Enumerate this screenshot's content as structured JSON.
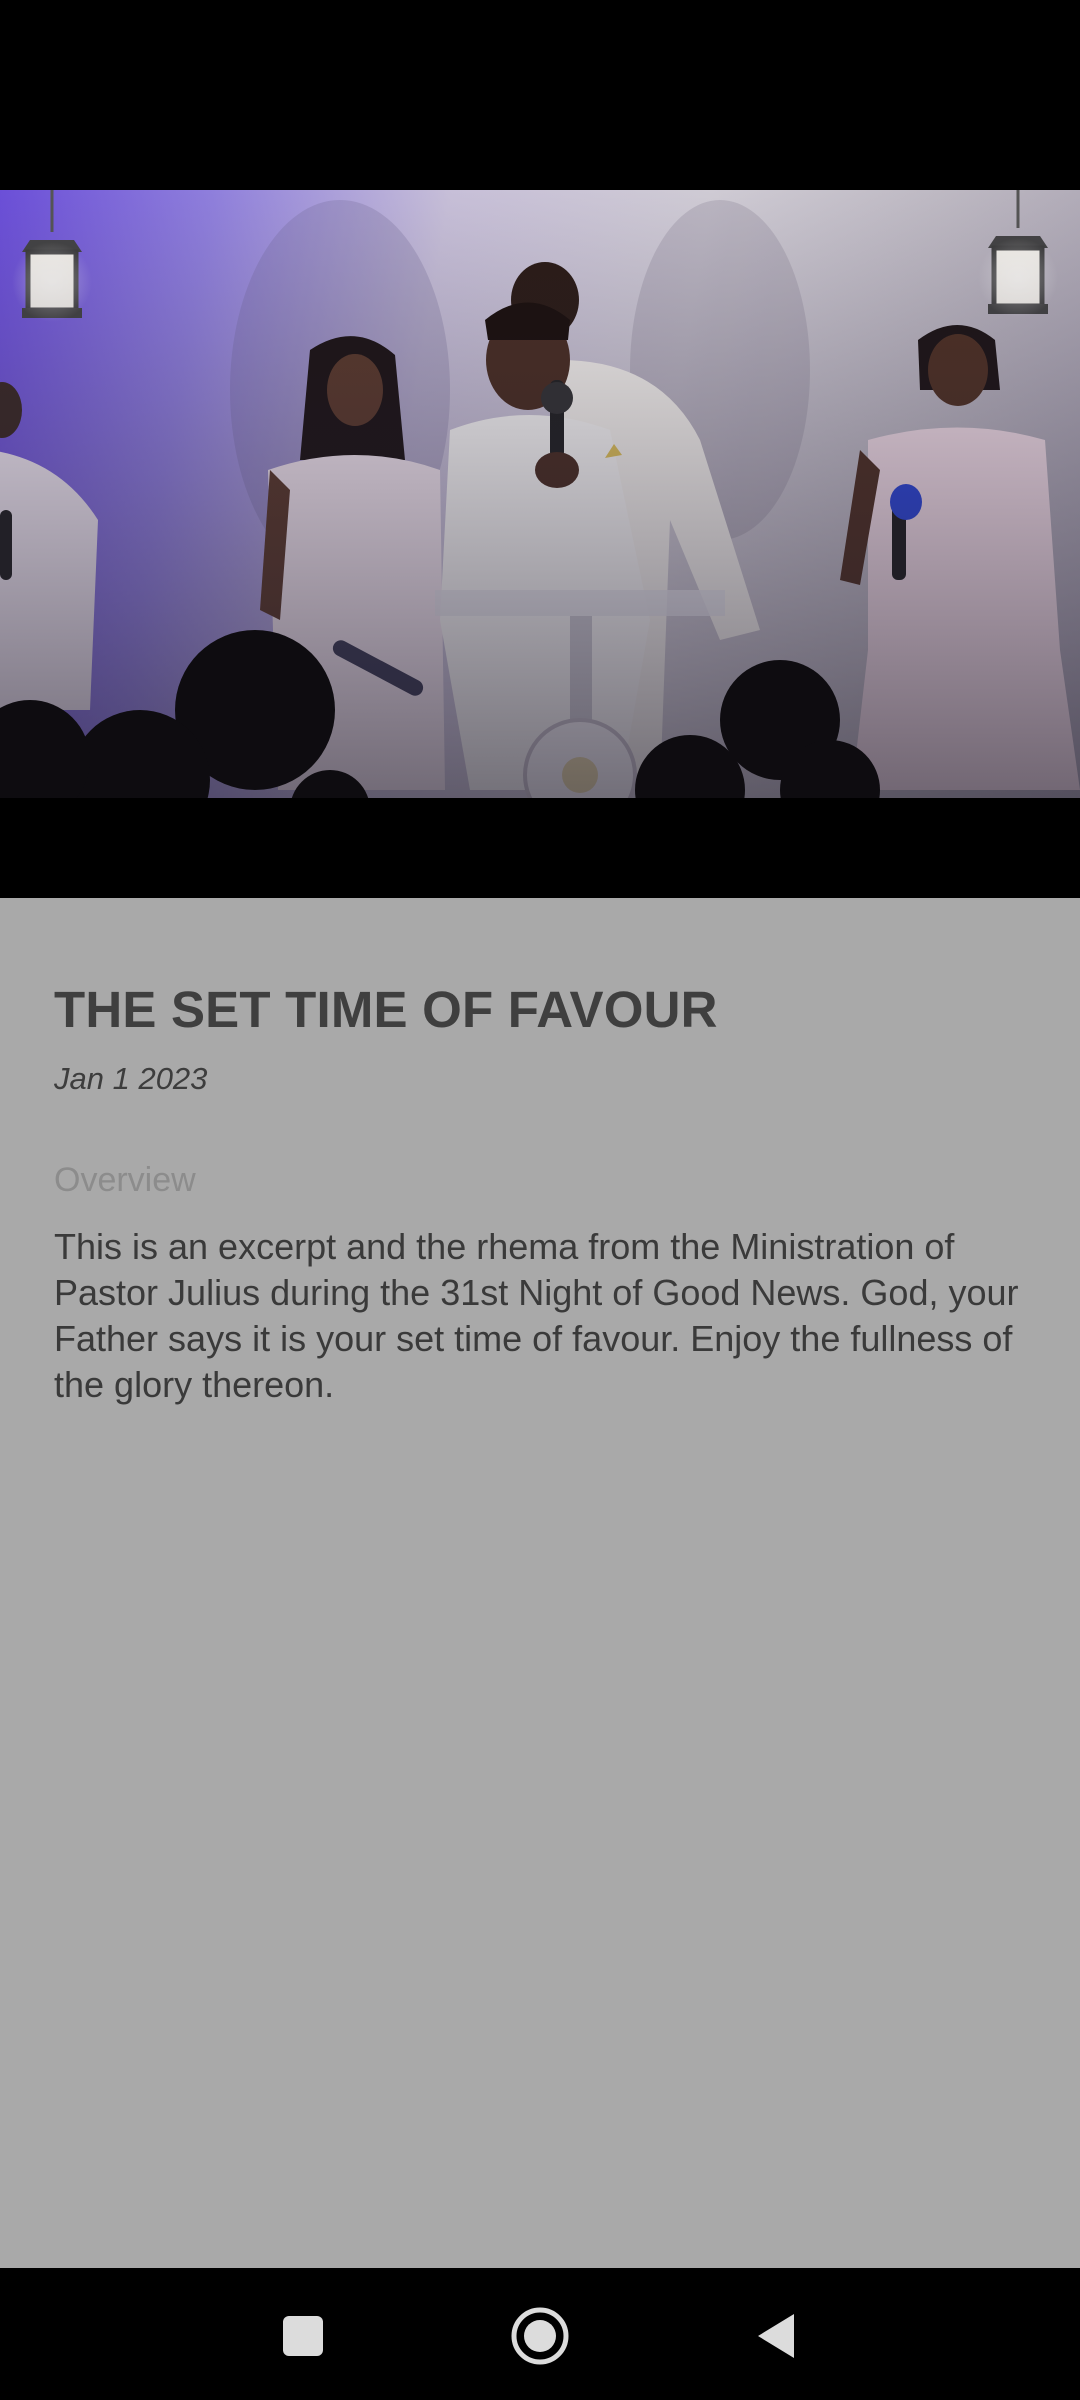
{
  "video": {
    "scene": "stage-performance-image"
  },
  "sermon": {
    "title": "THE SET TIME OF FAVOUR",
    "date": "Jan 1 2023",
    "overview_label": "Overview",
    "description": "This is an excerpt and the rhema from the Ministration of Pastor Julius during the 31st Night of Good News. God, your Father says it is your set time of favour. Enjoy the fullness of the glory thereon."
  },
  "nav": {
    "recents_icon": "square-icon",
    "home_icon": "circle-icon",
    "back_icon": "triangle-icon"
  },
  "colors": {
    "background": "#a9a9a9",
    "title": "#3f3f3f",
    "overview_label": "#8c8c8c",
    "nav_bar": "#000000"
  }
}
